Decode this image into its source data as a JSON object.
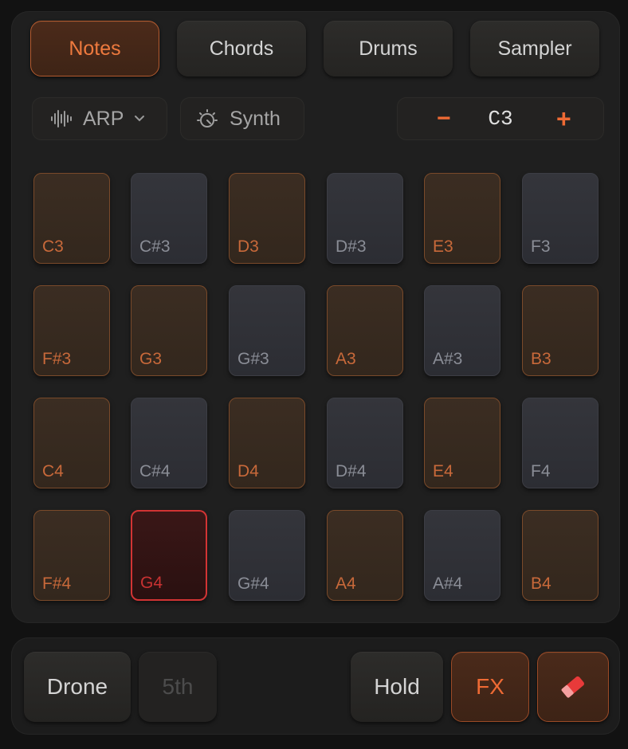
{
  "tabs": [
    {
      "label": "Notes",
      "active": true
    },
    {
      "label": "Chords",
      "active": false
    },
    {
      "label": "Drums",
      "active": false
    },
    {
      "label": "Sampler",
      "active": false
    }
  ],
  "controls": {
    "arp_label": "ARP",
    "synth_label": "Synth",
    "octave_minus": "−",
    "octave_value": "C3",
    "octave_plus": "+"
  },
  "pads": [
    {
      "note": "C3",
      "kind": "white"
    },
    {
      "note": "C#3",
      "kind": "black"
    },
    {
      "note": "D3",
      "kind": "white"
    },
    {
      "note": "D#3",
      "kind": "black"
    },
    {
      "note": "E3",
      "kind": "white"
    },
    {
      "note": "F3",
      "kind": "black"
    },
    {
      "note": "F#3",
      "kind": "white"
    },
    {
      "note": "G3",
      "kind": "white"
    },
    {
      "note": "G#3",
      "kind": "black"
    },
    {
      "note": "A3",
      "kind": "white"
    },
    {
      "note": "A#3",
      "kind": "black"
    },
    {
      "note": "B3",
      "kind": "white"
    },
    {
      "note": "C4",
      "kind": "white"
    },
    {
      "note": "C#4",
      "kind": "black"
    },
    {
      "note": "D4",
      "kind": "white"
    },
    {
      "note": "D#4",
      "kind": "black"
    },
    {
      "note": "E4",
      "kind": "white"
    },
    {
      "note": "F4",
      "kind": "black"
    },
    {
      "note": "F#4",
      "kind": "white"
    },
    {
      "note": "G4",
      "kind": "active"
    },
    {
      "note": "G#4",
      "kind": "black"
    },
    {
      "note": "A4",
      "kind": "white"
    },
    {
      "note": "A#4",
      "kind": "black"
    },
    {
      "note": "B4",
      "kind": "white"
    }
  ],
  "bottom": {
    "drone_label": "Drone",
    "fifth_label": "5th",
    "hold_label": "Hold",
    "fx_label": "FX",
    "eraser_icon": "eraser-icon"
  },
  "colors": {
    "accent": "#ee6a34",
    "active_pad": "#d23434"
  }
}
